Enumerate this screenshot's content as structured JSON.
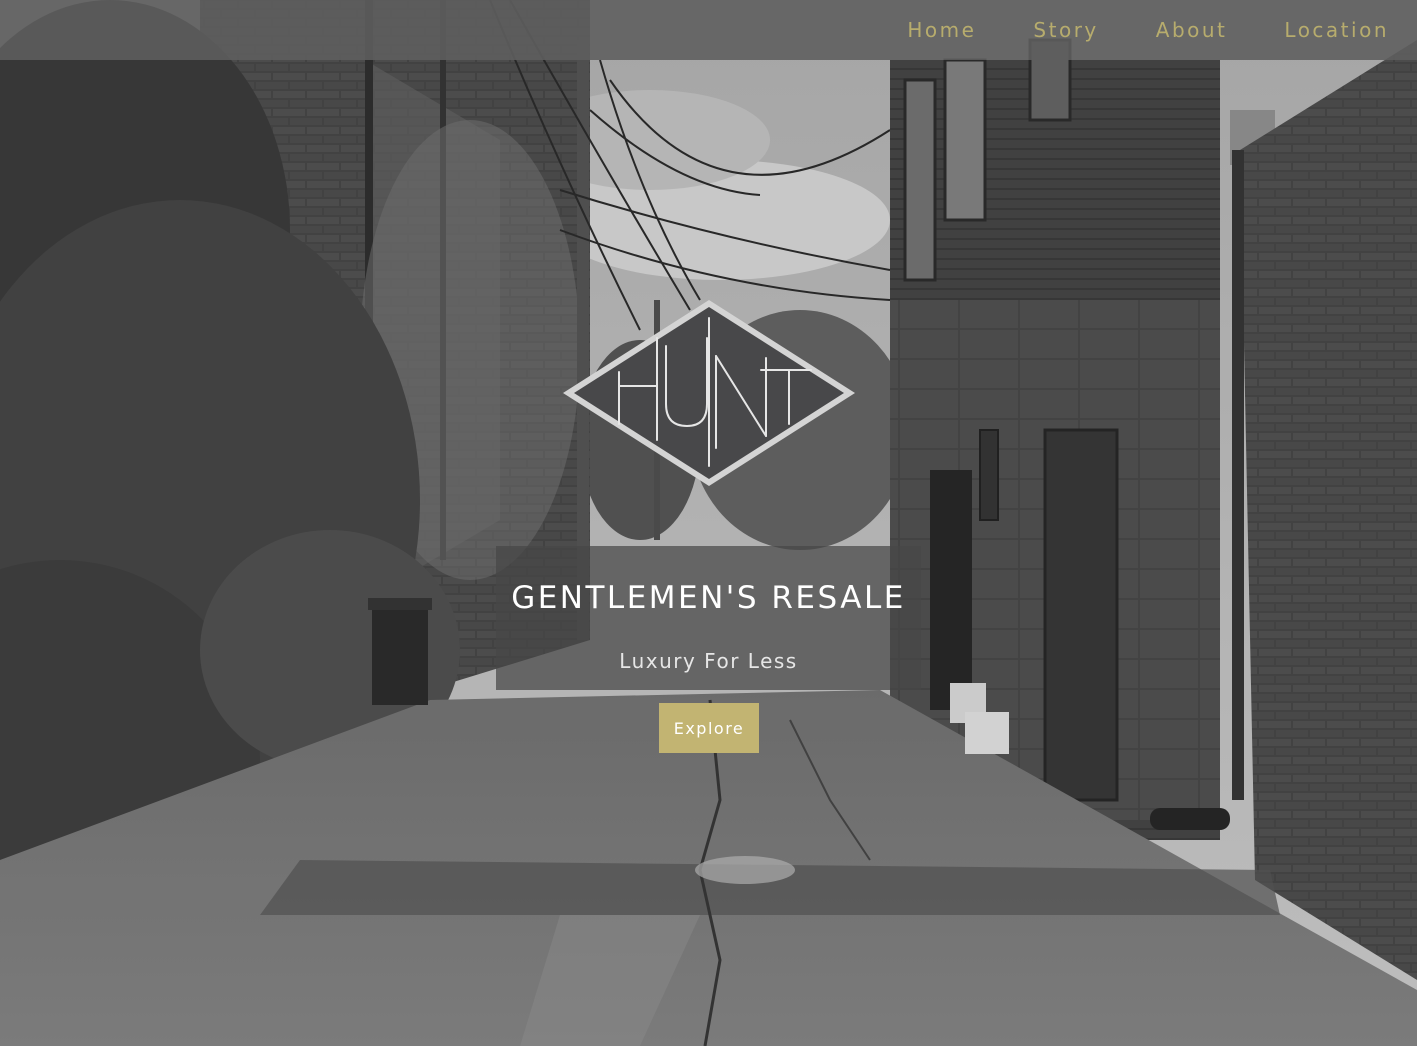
{
  "nav": {
    "items": [
      {
        "label": "Home"
      },
      {
        "label": "Story"
      },
      {
        "label": "About"
      },
      {
        "label": "Location"
      }
    ]
  },
  "brand": {
    "logo_text": "HUNT",
    "logo_icon": "hunt-diamond-logo"
  },
  "hero": {
    "title": "GENTLEMEN'S RESALE",
    "subtitle": "Luxury For Less",
    "button_label": "Explore"
  },
  "colors": {
    "accent": "#c2b472",
    "nav_text": "#b7ac6d",
    "navbar_bg": "#5f5f5f",
    "logo_fill": "#4a4a4c",
    "logo_border": "#d6d6d6"
  }
}
